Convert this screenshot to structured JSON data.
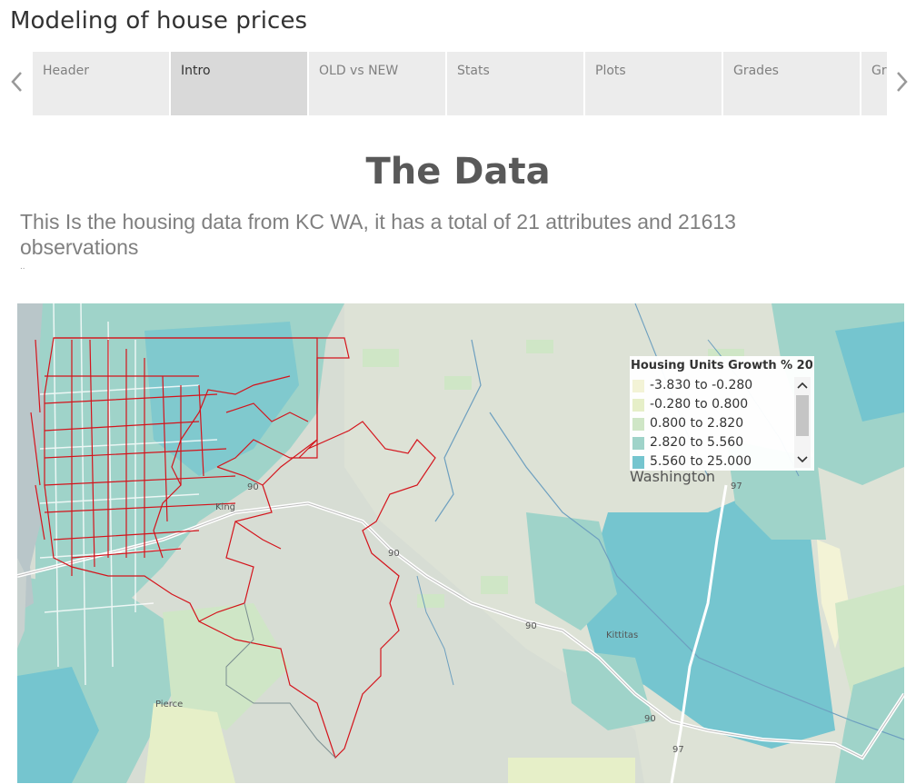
{
  "story": {
    "title": "Modeling of house prices"
  },
  "tabs": [
    {
      "label": "Header",
      "active": false
    },
    {
      "label": "Intro",
      "active": true
    },
    {
      "label": "OLD vs NEW",
      "active": false
    },
    {
      "label": "Stats",
      "active": false
    },
    {
      "label": "Plots",
      "active": false
    },
    {
      "label": "Grades",
      "active": false
    },
    {
      "label": "Gr",
      "active": false
    }
  ],
  "icons": {
    "prev": "chevron-left-icon",
    "next": "chevron-right-icon",
    "scroll_up": "chevron-up-icon",
    "scroll_down": "chevron-down-icon"
  },
  "content": {
    "heading": "The Data",
    "description": "This Is the housing data from KC WA, it has a total of 21 attributes and 21613 observations",
    "ellipsis": ".."
  },
  "map": {
    "legend": {
      "title": "Housing Units Growth % 20..",
      "items": [
        {
          "label": "-3.830 to -0.280",
          "color": "#f3f3d6"
        },
        {
          "label": "-0.280 to 0.800",
          "color": "#e6efc8"
        },
        {
          "label": "0.800 to 2.820",
          "color": "#cfe6c6"
        },
        {
          "label": "2.820 to 5.560",
          "color": "#9fd3c9"
        },
        {
          "label": "5.560 to 25.000",
          "color": "#75c5cf"
        }
      ]
    },
    "state_label": "Washington",
    "place_labels": {
      "king": "King",
      "pierce": "Pierce",
      "kittitas": "Kittitas"
    },
    "road_shields": {
      "i90_a": "90",
      "i90_b": "90",
      "i90_c": "90",
      "i90_d": "90",
      "us97_a": "97",
      "us97_b": "97"
    },
    "boundary_color": "#d4141c",
    "water_color": "#b9c6c9"
  }
}
